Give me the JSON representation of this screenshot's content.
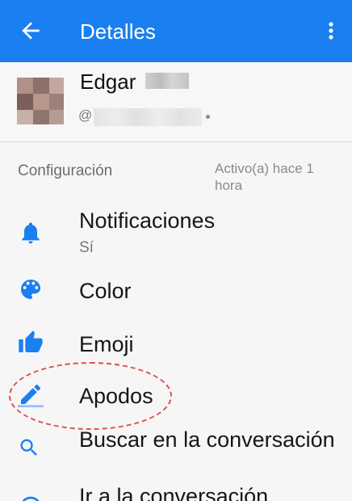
{
  "appbar": {
    "title": "Detalles",
    "back_icon": "arrow-back-icon",
    "more_icon": "more-vert-icon",
    "color": "#1a7ff0"
  },
  "profile": {
    "name": "Edgar",
    "username_prefix": "@",
    "active_status": "Activo(a) hace 1 hora"
  },
  "settings": {
    "section_title": "Configuración",
    "items": [
      {
        "label": "Notificaciones",
        "sublabel": "Sí",
        "icon": "bell-icon"
      },
      {
        "label": "Color",
        "icon": "palette-icon"
      },
      {
        "label": "Emoji",
        "icon": "thumbs-up-icon"
      },
      {
        "label": "Apodos",
        "icon": "pencil-icon"
      },
      {
        "label": "Buscar en la conversación",
        "icon": "search-icon"
      },
      {
        "label": "Ir a la conversación",
        "icon": "chat-icon"
      }
    ]
  },
  "accent_color": "#1a7ff0",
  "highlight_color": "#e0504f"
}
